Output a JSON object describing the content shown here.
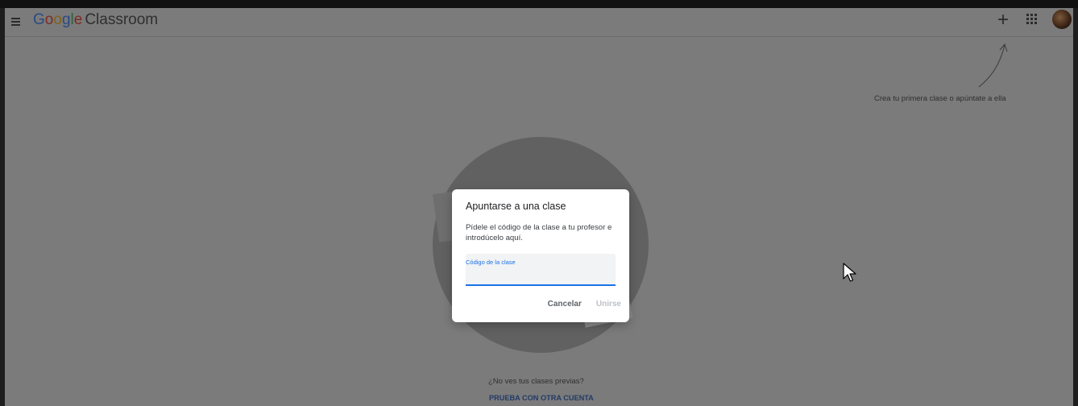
{
  "header": {
    "logo_google": [
      "G",
      "o",
      "o",
      "g",
      "l",
      "e"
    ],
    "logo_product": "Classroom",
    "plus_label": "+",
    "icons": {
      "menu": "hamburger-menu-icon",
      "plus": "plus-icon",
      "apps": "apps-grid-icon"
    }
  },
  "hint": {
    "text": "Crea tu primera clase o apúntate a ella"
  },
  "dialog": {
    "title": "Apuntarse a una clase",
    "text": "Pídele el código de la clase a tu profesor e introdúcelo aquí.",
    "field_label": "Código de la clase",
    "field_value": "",
    "cancel_label": "Cancelar",
    "join_label": "Unirse"
  },
  "footer": {
    "prev_text": "¿No ves tus clases previas?",
    "other_account": "PRUEBA CON OTRA CUENTA"
  },
  "colors": {
    "overlay_bg": "#7b7b7b",
    "accent": "#1a73e8",
    "disabled_text": "#bdc1c6"
  }
}
